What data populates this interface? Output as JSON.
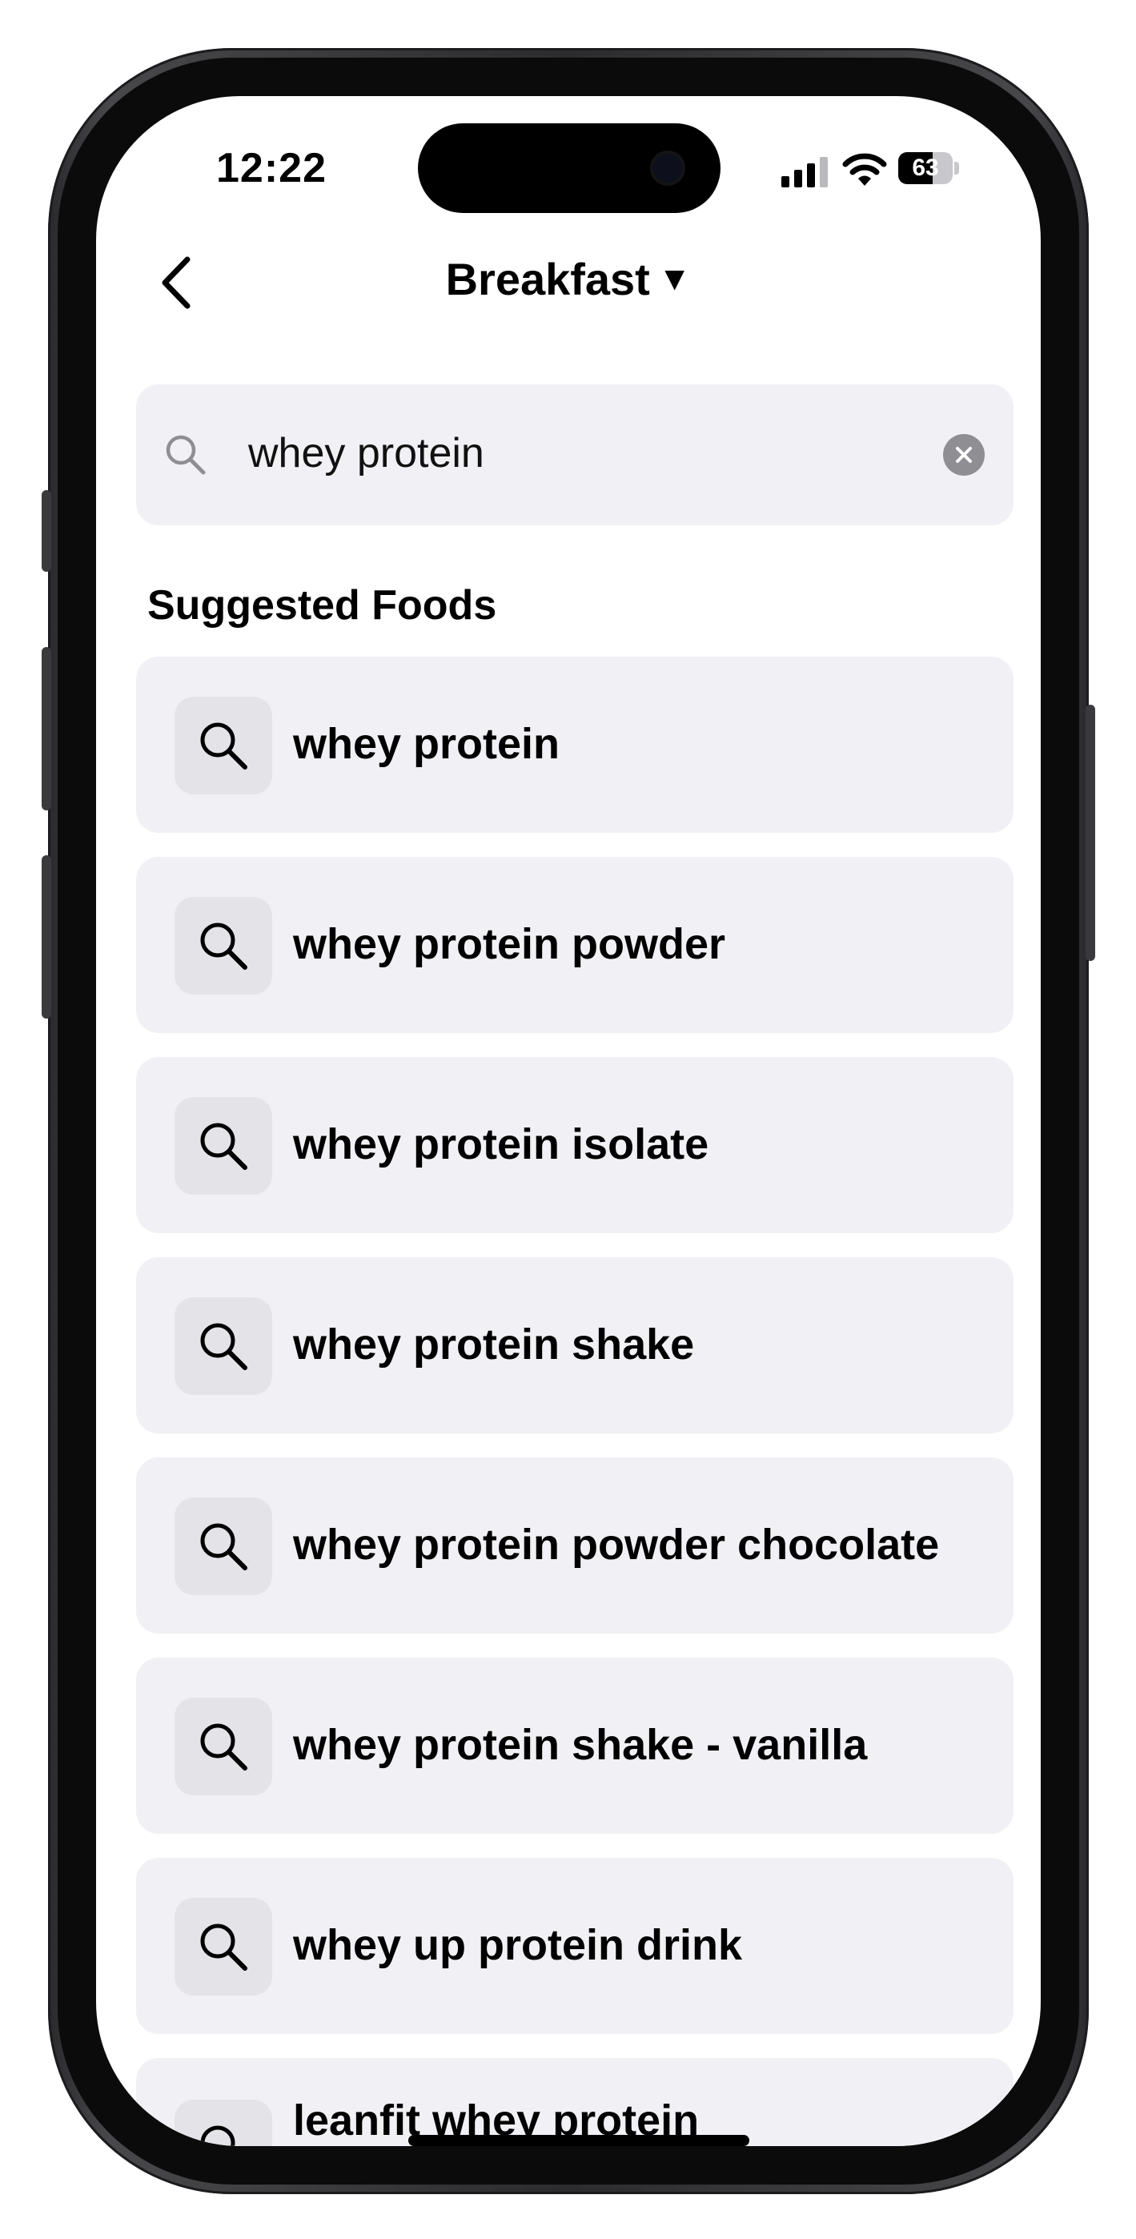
{
  "status_bar": {
    "time": "12:22",
    "battery_percent": "63",
    "battery_level": 0.63
  },
  "nav": {
    "back_icon": "chevron-left-icon",
    "title": "Breakfast",
    "title_caret": "▼"
  },
  "search": {
    "icon": "search-icon",
    "query": "whey protein",
    "clear_icon": "clear-circle-icon"
  },
  "section_title": "Suggested Foods",
  "suggestions": [
    {
      "label": "whey protein"
    },
    {
      "label": "whey protein powder"
    },
    {
      "label": "whey protein isolate"
    },
    {
      "label": "whey protein shake"
    },
    {
      "label": "whey protein powder chocolate"
    },
    {
      "label": "whey protein shake - vanilla"
    },
    {
      "label": "whey up protein drink"
    },
    {
      "label": "leanfit whey protein shake - vanilla"
    }
  ],
  "colors": {
    "card_bg": "#f1f1f5",
    "icon_bg": "#e3e3e8",
    "clear_bg": "#8e8e93"
  }
}
